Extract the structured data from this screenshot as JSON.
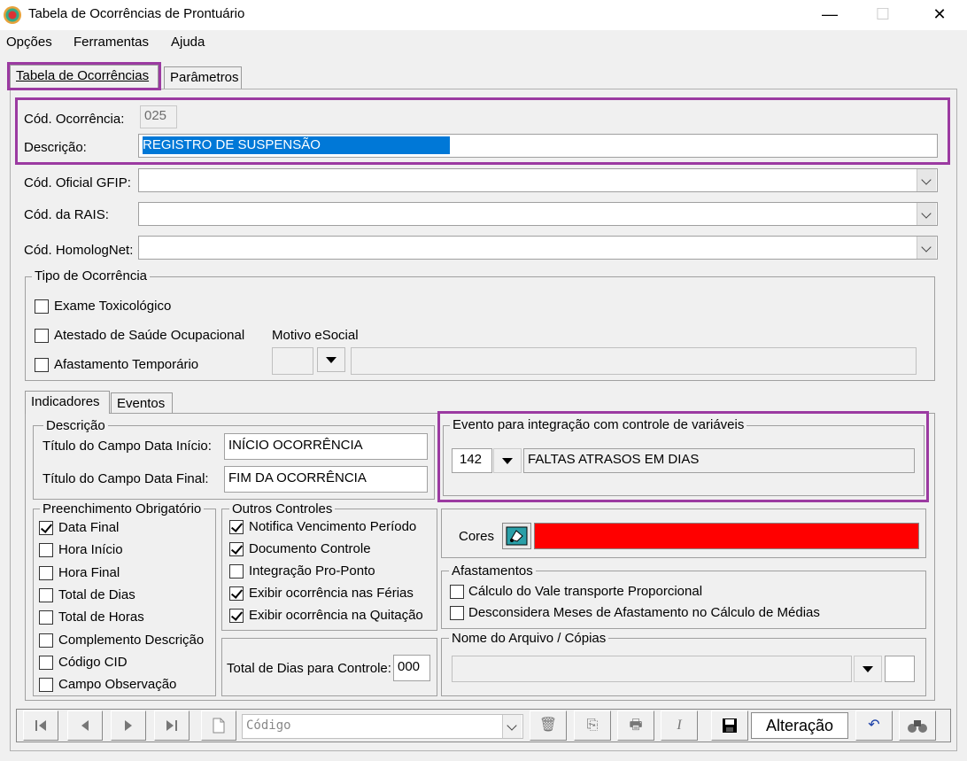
{
  "window": {
    "title": "Tabela de Ocorrências de Prontuário",
    "minimize_glyph": "—",
    "maximize_glyph": "☐",
    "close_glyph": "✕"
  },
  "menu": [
    "Opções",
    "Ferramentas",
    "Ajuda"
  ],
  "tabs": [
    "Tabela de Ocorrências",
    "Parâmetros"
  ],
  "form": {
    "cod_ocorrencia_label": "Cód. Ocorrência:",
    "cod_ocorrencia_value": "025",
    "descricao_label": "Descrição:",
    "descricao_value": "REGISTRO DE SUSPENSÃO",
    "gfip_label": "Cód. Oficial GFIP:",
    "rais_label": "Cód. da RAIS:",
    "homolognet_label": "Cód. HomologNet:"
  },
  "tipo_ocorrencia": {
    "legend": "Tipo de Ocorrência",
    "items": [
      {
        "label": "Exame Toxicológico",
        "checked": false
      },
      {
        "label": "Atestado de Saúde Ocupacional",
        "checked": false
      },
      {
        "label": "Afastamento Temporário",
        "checked": false
      }
    ],
    "motivo_label": "Motivo eSocial"
  },
  "subtabs": [
    "Indicadores",
    "Eventos"
  ],
  "descricao_group": {
    "legend": "Descrição",
    "inicio_label": "Título do Campo Data Início:",
    "inicio_value": "INÍCIO OCORRÊNCIA",
    "final_label": "Título do Campo Data Final:",
    "final_value": "FIM DA OCORRÊNCIA"
  },
  "evento_group": {
    "legend": "Evento para integração com controle de variáveis",
    "code": "142",
    "description": "FALTAS ATRASOS EM DIAS"
  },
  "preenchimento": {
    "legend": "Preenchimento Obrigatório",
    "items": [
      {
        "label": "Data Final",
        "checked": true
      },
      {
        "label": "Hora Início",
        "checked": false
      },
      {
        "label": "Hora Final",
        "checked": false
      },
      {
        "label": "Total de Dias",
        "checked": false
      },
      {
        "label": "Total de Horas",
        "checked": false
      },
      {
        "label": "Complemento Descrição",
        "checked": false
      },
      {
        "label": "Código CID",
        "checked": false
      },
      {
        "label": "Campo Observação",
        "checked": false
      }
    ]
  },
  "outros": {
    "legend": "Outros Controles",
    "items": [
      {
        "label": "Notifica Vencimento Período",
        "checked": true
      },
      {
        "label": "Documento Controle",
        "checked": true
      },
      {
        "label": "Integração Pro-Ponto",
        "checked": false
      },
      {
        "label": "Exibir ocorrência nas Férias",
        "checked": true
      },
      {
        "label": "Exibir ocorrência na Quitação",
        "checked": true
      }
    ],
    "total_dias_label": "Total de Dias para Controle:",
    "total_dias_value": "000"
  },
  "cores": {
    "label": "Cores",
    "color": "#ff0000"
  },
  "afastamentos": {
    "legend": "Afastamentos",
    "items": [
      {
        "label": "Cálculo do Vale transporte Proporcional",
        "checked": false
      },
      {
        "label": "Desconsidera Meses de Afastamento no Cálculo de Médias",
        "checked": false
      }
    ]
  },
  "arquivo": {
    "legend": "Nome do Arquivo / Cópias"
  },
  "toolbar": {
    "search_placeholder": "Código",
    "mode_label": "Alteração",
    "icons": [
      "first-icon",
      "prev-icon",
      "next-icon",
      "last-icon",
      "new-document-icon",
      "delete-icon",
      "copy-icon",
      "print-icon",
      "italic-icon",
      "save-icon",
      "undo-icon",
      "binoculars-icon"
    ]
  }
}
